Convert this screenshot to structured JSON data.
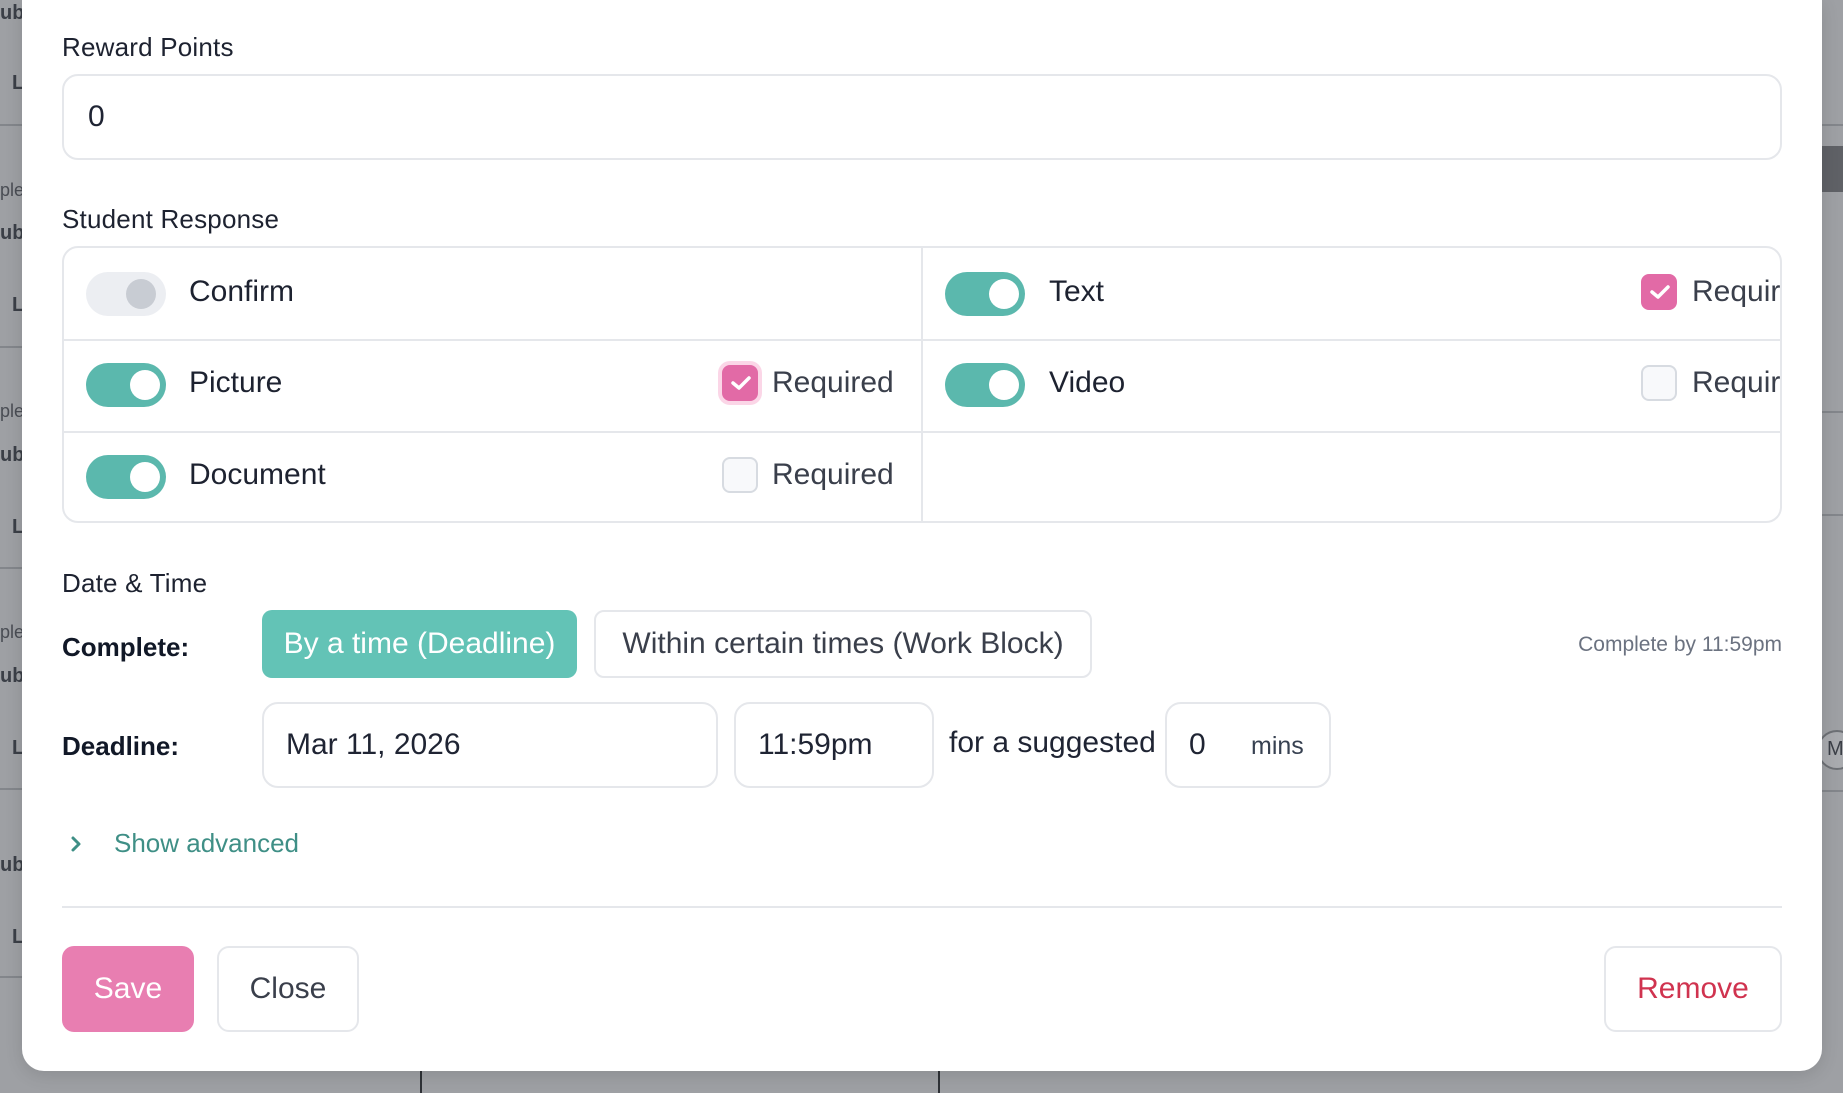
{
  "background": {
    "left_fragments": [
      "ubj",
      "L",
      "ple",
      "ubj",
      "L",
      "ple",
      "ubj",
      "L",
      "ple",
      "ubj",
      "L",
      "ubj",
      "L"
    ],
    "right_circle_label": "M"
  },
  "reward_points": {
    "label": "Reward Points",
    "value": "0"
  },
  "student_response": {
    "label": "Student Response",
    "options": [
      {
        "label": "Confirm",
        "enabled": false,
        "has_required": false
      },
      {
        "label": "Text",
        "enabled": true,
        "has_required": true,
        "required_label": "Required",
        "required": true
      },
      {
        "label": "Picture",
        "enabled": true,
        "has_required": true,
        "required_label": "Required",
        "required": true
      },
      {
        "label": "Video",
        "enabled": true,
        "has_required": true,
        "required_label": "Required",
        "required": false
      },
      {
        "label": "Document",
        "enabled": true,
        "has_required": true,
        "required_label": "Required",
        "required": false
      }
    ]
  },
  "date_time": {
    "label": "Date & Time",
    "complete_label": "Complete:",
    "complete_options": [
      "By a time (Deadline)",
      "Within certain times (Work Block)"
    ],
    "complete_selected": "By a time (Deadline)",
    "complete_hint": "Complete by 11:59pm",
    "deadline_label": "Deadline:",
    "deadline_date": "Mar 11, 2026",
    "deadline_time": "11:59pm",
    "suggested_text": "for a suggested",
    "suggested_value": "0",
    "suggested_unit": "mins"
  },
  "advanced": {
    "label": "Show advanced"
  },
  "footer": {
    "save_label": "Save",
    "close_label": "Close",
    "remove_label": "Remove"
  },
  "colors": {
    "accent_teal": "#63c3b6",
    "toggle_on": "#5bb8ad",
    "pink": "#e26aa6",
    "save_pink": "#e87eb1",
    "danger": "#d0334f"
  }
}
